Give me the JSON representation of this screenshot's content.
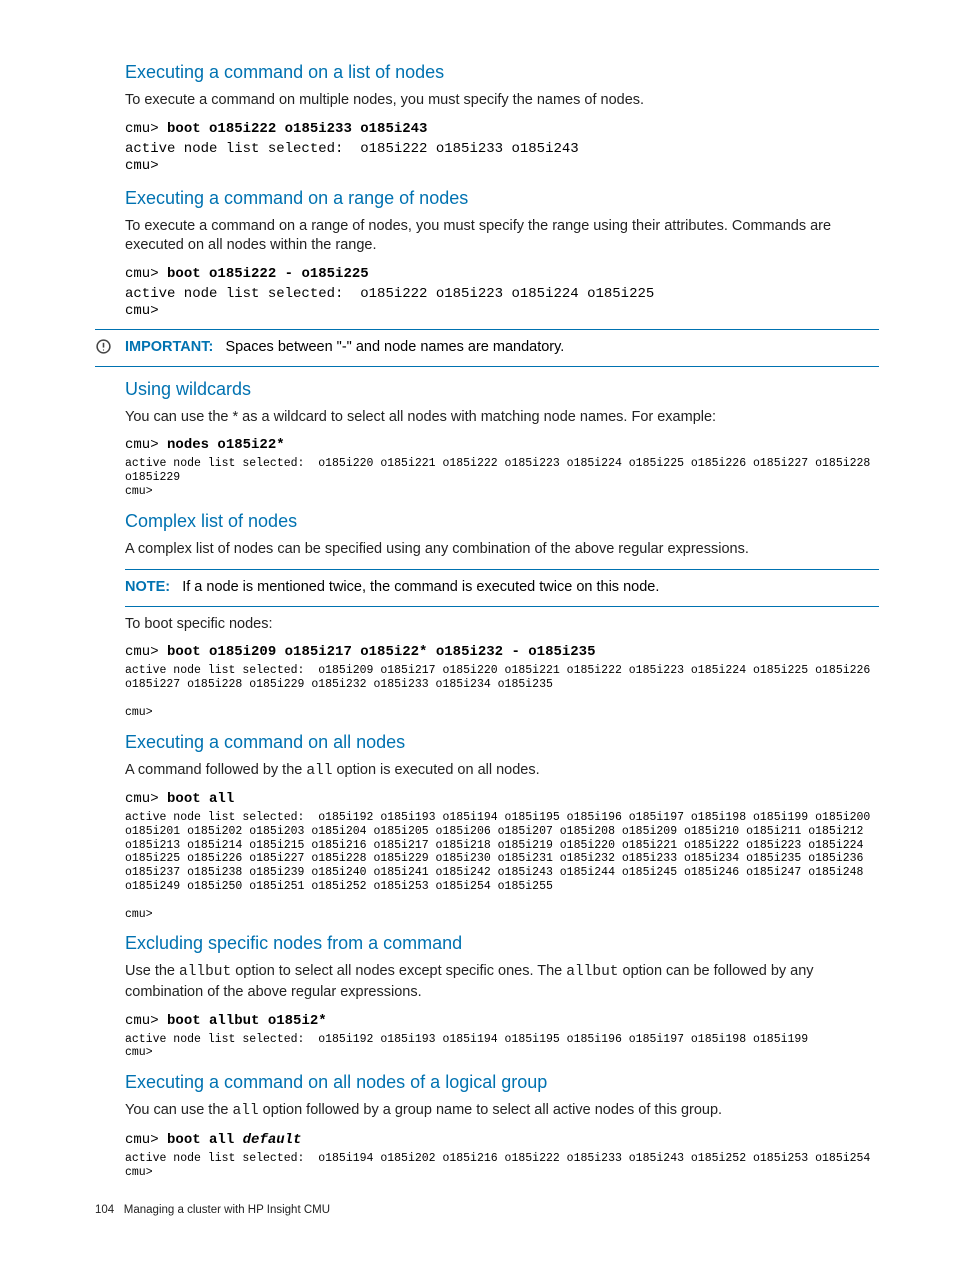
{
  "sections": {
    "list_of_nodes": {
      "heading": "Executing a command on a list of nodes",
      "body": "To execute a command on multiple nodes, you must specify the names of nodes.",
      "prompt": "cmu>",
      "cmd": "boot o185i222 o185i233 o185i243",
      "output": "active node list selected:  o185i222 o185i233 o185i243\ncmu>"
    },
    "range_of_nodes": {
      "heading": "Executing a command on a range of nodes",
      "body": "To execute a command on a range of nodes, you must specify the range using their attributes. Commands are executed on all nodes within the range.",
      "prompt": "cmu>",
      "cmd": "boot o185i222 - o185i225",
      "output": "active node list selected:  o185i222 o185i223 o185i224 o185i225\ncmu>",
      "callout_label": "IMPORTANT:",
      "callout_text": "Spaces between \"-\" and node names are mandatory."
    },
    "wildcards": {
      "heading": "Using wildcards",
      "body": "You can use the * as a wildcard to select all nodes with matching node names. For example:",
      "prompt": "cmu>",
      "cmd": "nodes o185i22*",
      "output": "active node list selected:  o185i220 o185i221 o185i222 o185i223 o185i224 o185i225 o185i226 o185i227 o185i228 o185i229\ncmu>"
    },
    "complex": {
      "heading": "Complex list of nodes",
      "body1": "A complex list of nodes can be specified using any combination of the above regular expressions.",
      "callout_label": "NOTE:",
      "callout_text": "If a node is mentioned twice, the command is executed twice on this node.",
      "body2": "To boot specific nodes:",
      "prompt": "cmu>",
      "cmd": "boot o185i209 o185i217 o185i22* o185i232 - o185i235",
      "output": "active node list selected:  o185i209 o185i217 o185i220 o185i221 o185i222 o185i223 o185i224 o185i225 o185i226 o185i227 o185i228 o185i229 o185i232 o185i233 o185i234 o185i235\n\ncmu>"
    },
    "all_nodes": {
      "heading": "Executing a command on all nodes",
      "body_pre": "A command followed by the ",
      "body_code": "all",
      "body_post": " option is executed on all nodes.",
      "prompt": "cmu>",
      "cmd": "boot all",
      "output": "active node list selected:  o185i192 o185i193 o185i194 o185i195 o185i196 o185i197 o185i198 o185i199 o185i200 o185i201 o185i202 o185i203 o185i204 o185i205 o185i206 o185i207 o185i208 o185i209 o185i210 o185i211 o185i212 o185i213 o185i214 o185i215 o185i216 o185i217 o185i218 o185i219 o185i220 o185i221 o185i222 o185i223 o185i224 o185i225 o185i226 o185i227 o185i228 o185i229 o185i230 o185i231 o185i232 o185i233 o185i234 o185i235 o185i236 o185i237 o185i238 o185i239 o185i240 o185i241 o185i242 o185i243 o185i244 o185i245 o185i246 o185i247 o185i248 o185i249 o185i250 o185i251 o185i252 o185i253 o185i254 o185i255\n\ncmu>"
    },
    "excluding": {
      "heading": "Excluding specific nodes from a command",
      "body_parts": {
        "p0": "Use the ",
        "c1": "allbut",
        "p1": " option to select all nodes except specific ones. The ",
        "c2": "allbut",
        "p2": " option can be followed by any combination of the above regular expressions."
      },
      "prompt": "cmu>",
      "cmd": "boot allbut o185i2*",
      "output": "active node list selected:  o185i192 o185i193 o185i194 o185i195 o185i196 o185i197 o185i198 o185i199\ncmu>"
    },
    "logical_group": {
      "heading": "Executing a command on all nodes of a logical group",
      "body_parts": {
        "p0": "You can use the ",
        "c1": "all",
        "p1": " option followed by a group name to select all active nodes of this group."
      },
      "prompt": "cmu>",
      "cmd": "boot all ",
      "cmd_italic": "default",
      "output": "active node list selected:  o185i194 o185i202 o185i216 o185i222 o185i233 o185i243 o185i252 o185i253 o185i254\ncmu>"
    }
  },
  "footer": {
    "page_no": "104",
    "chapter": "Managing a cluster with HP Insight CMU"
  }
}
